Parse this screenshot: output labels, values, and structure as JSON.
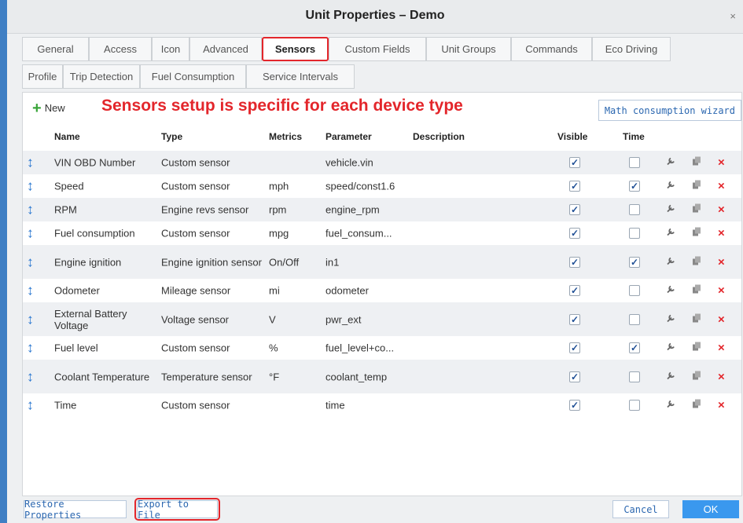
{
  "window": {
    "title": "Unit Properties – Demo",
    "close": "×"
  },
  "tabs_row1": [
    {
      "label": "General"
    },
    {
      "label": "Access"
    },
    {
      "label": "Icon"
    },
    {
      "label": "Advanced"
    },
    {
      "label": "Sensors",
      "active": true
    },
    {
      "label": "Custom Fields"
    },
    {
      "label": "Unit Groups"
    },
    {
      "label": "Commands"
    },
    {
      "label": "Eco Driving"
    }
  ],
  "tabs_row2": [
    {
      "label": "Profile"
    },
    {
      "label": "Trip Detection"
    },
    {
      "label": "Fuel Consumption"
    },
    {
      "label": "Service Intervals"
    }
  ],
  "toolbar": {
    "new_label": "New",
    "annotation": "Sensors setup is specific for each device type",
    "wizard_label": "Math consumption wizard"
  },
  "table": {
    "headers": {
      "name": "Name",
      "type": "Type",
      "metrics": "Metrics",
      "parameter": "Parameter",
      "description": "Description",
      "visible": "Visible",
      "time": "Time"
    },
    "rows": [
      {
        "name": "VIN OBD Number",
        "type": "Custom sensor",
        "metrics": "",
        "parameter": "vehicle.vin",
        "visible": true,
        "time": false
      },
      {
        "name": "Speed",
        "type": "Custom sensor",
        "metrics": "mph",
        "parameter": "speed/const1.6",
        "visible": true,
        "time": true
      },
      {
        "name": "RPM",
        "type": "Engine revs sensor",
        "metrics": "rpm",
        "parameter": "engine_rpm",
        "visible": true,
        "time": false
      },
      {
        "name": "Fuel consumption",
        "type": "Custom sensor",
        "metrics": "mpg",
        "parameter": "fuel_consum...",
        "visible": true,
        "time": false
      },
      {
        "name": "Engine ignition",
        "type": "Engine ignition sensor",
        "metrics": "On/Off",
        "parameter": "in1",
        "visible": true,
        "time": true
      },
      {
        "name": "Odometer",
        "type": "Mileage sensor",
        "metrics": "mi",
        "parameter": "odometer",
        "visible": true,
        "time": false
      },
      {
        "name": "External Battery Voltage",
        "type": "Voltage sensor",
        "metrics": "V",
        "parameter": "pwr_ext",
        "visible": true,
        "time": false
      },
      {
        "name": "Fuel level",
        "type": "Custom sensor",
        "metrics": "%",
        "parameter": "fuel_level+co...",
        "visible": true,
        "time": true
      },
      {
        "name": "Coolant Temperature",
        "type": "Temperature sensor",
        "metrics": "°F",
        "parameter": "coolant_temp",
        "visible": true,
        "time": false
      },
      {
        "name": "Time",
        "type": "Custom sensor",
        "metrics": "",
        "parameter": "time",
        "visible": true,
        "time": false
      }
    ]
  },
  "footer": {
    "restore": "Restore Properties",
    "export": "Export to File",
    "cancel": "Cancel",
    "ok": "OK"
  },
  "icons": {
    "drag": "↕",
    "edit": "wrench-icon",
    "copy": "copy-icon",
    "delete": "×",
    "check": "✓"
  },
  "colors": {
    "accent": "#2b67b0",
    "highlight": "#e3262b",
    "ok_button": "#3a98ee",
    "add_green": "#3aa53a"
  }
}
